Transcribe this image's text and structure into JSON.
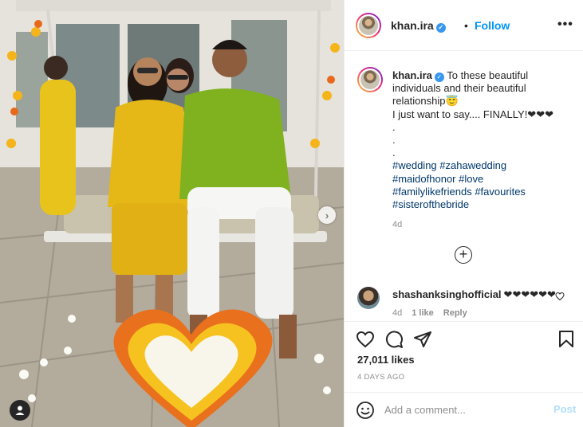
{
  "post": {
    "username": "khan.ira",
    "follow_label": "Follow",
    "separator": "•",
    "more_label": "•••",
    "verified_mark": "✓"
  },
  "photo": {
    "next_label": "›",
    "icons": {
      "next": "chevron-right-icon",
      "tagged_users": "user-tag-icon"
    }
  },
  "caption": {
    "username": "khan.ira",
    "text": "To these beautiful individuals and their beautiful relationship😇",
    "line2": "I just want to say.... FINALLY!❤❤❤",
    "dots": [
      ".",
      ".",
      "."
    ],
    "hashtags": [
      "#wedding",
      "#zahawedding",
      "#maidofhonor",
      "#love",
      "#familylikefriends",
      "#favourites",
      "#sisterofthebride"
    ],
    "time": "4d"
  },
  "load_more_label": "+",
  "comment": {
    "username": "shashanksinghofficial",
    "text": "❤❤❤❤❤❤",
    "time": "4d",
    "likes": "1 like",
    "reply_label": "Reply"
  },
  "actions": {
    "icons": [
      "heart-icon",
      "comment-icon",
      "share-icon",
      "bookmark-icon"
    ]
  },
  "likes_text": "27,011 likes",
  "posted_ago": "4 DAYS AGO",
  "add_comment": {
    "placeholder": "Add a comment...",
    "post_label": "Post"
  },
  "colors": {
    "link": "#0095f6",
    "hashtag": "#00376b",
    "muted": "#8e8e8e",
    "post_disabled": "#b2dffc"
  }
}
